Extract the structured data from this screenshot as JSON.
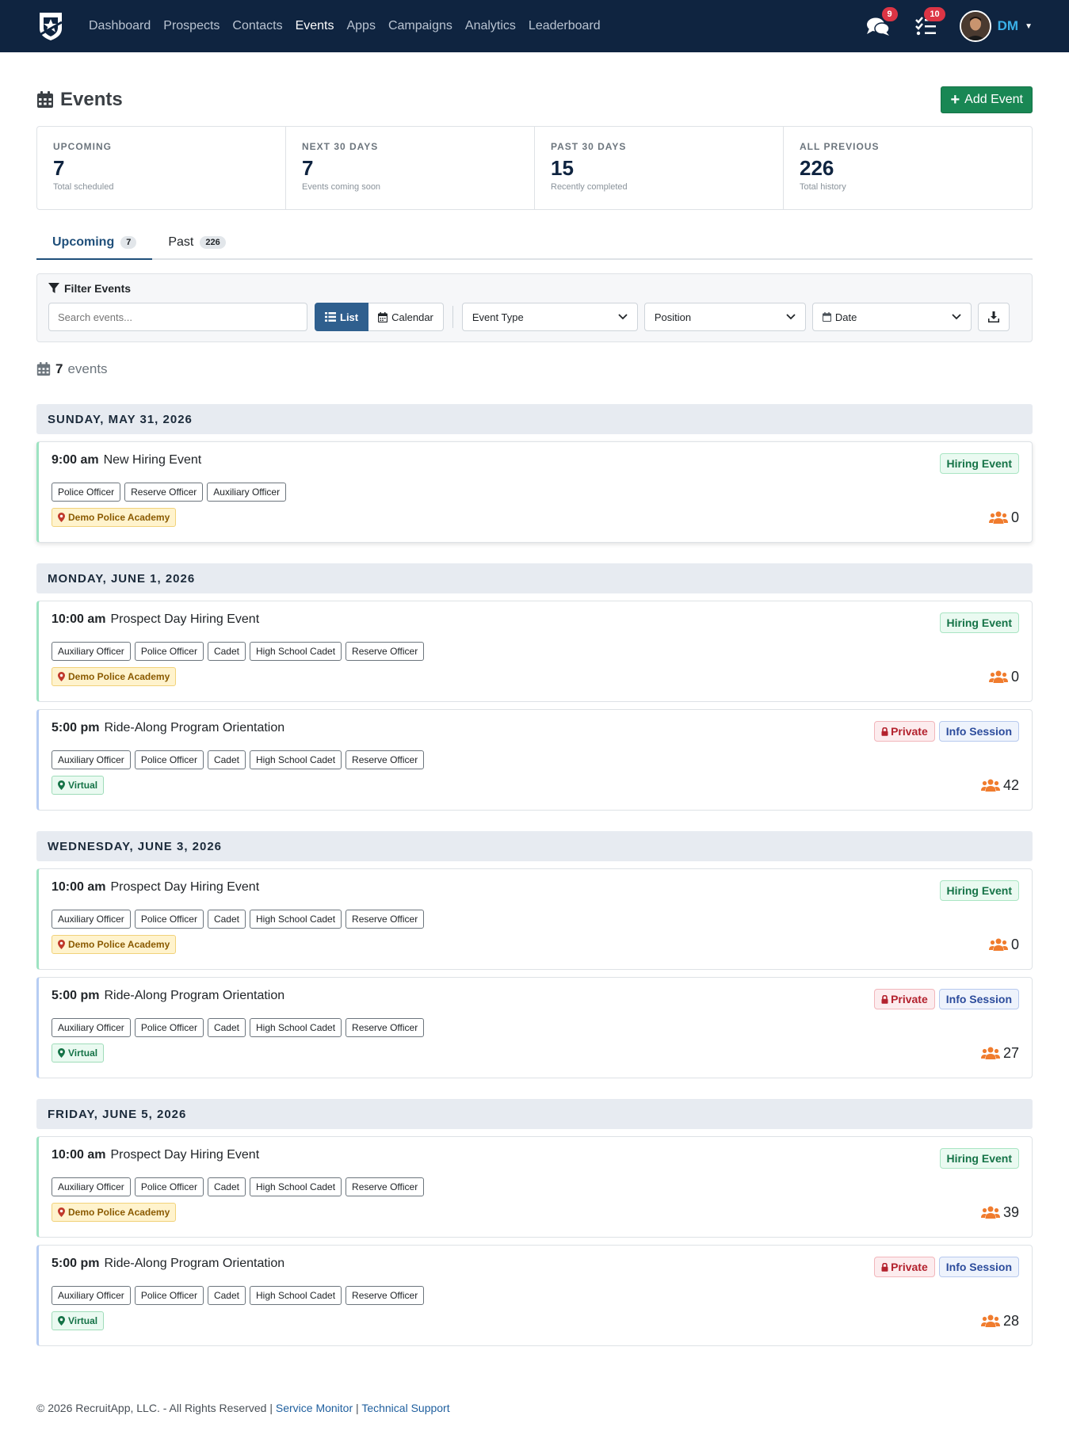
{
  "nav": {
    "links": [
      "Dashboard",
      "Prospects",
      "Contacts",
      "Events",
      "Apps",
      "Campaigns",
      "Analytics",
      "Leaderboard"
    ],
    "active": "Events",
    "messages_badge": "9",
    "tasks_badge": "10",
    "user_initials": "DM"
  },
  "page": {
    "title": "Events",
    "add_button": "Add Event"
  },
  "stats": [
    {
      "label": "UPCOMING",
      "value": "7",
      "sub": "Total scheduled"
    },
    {
      "label": "NEXT 30 DAYS",
      "value": "7",
      "sub": "Events coming soon"
    },
    {
      "label": "PAST 30 DAYS",
      "value": "15",
      "sub": "Recently completed"
    },
    {
      "label": "ALL PREVIOUS",
      "value": "226",
      "sub": "Total history"
    }
  ],
  "tabs": [
    {
      "label": "Upcoming",
      "count": "7"
    },
    {
      "label": "Past",
      "count": "226"
    }
  ],
  "filter": {
    "title": "Filter Events",
    "search_placeholder": "Search events...",
    "list_label": "List",
    "calendar_label": "Calendar",
    "event_type": "Event Type",
    "position": "Position",
    "date": "Date"
  },
  "events_count": {
    "number": "7",
    "label": "events"
  },
  "days": [
    {
      "date": "SUNDAY, MAY 31, 2026",
      "events": [
        {
          "time": "9:00 am",
          "title": "New Hiring Event",
          "private": false,
          "type": "Hiring Event",
          "positions": [
            "Police Officer",
            "Reserve Officer",
            "Auxiliary Officer"
          ],
          "location": "Demo Police Academy",
          "attendees": "0"
        }
      ]
    },
    {
      "date": "MONDAY, JUNE 1, 2026",
      "events": [
        {
          "time": "10:00 am",
          "title": "Prospect Day Hiring Event",
          "private": false,
          "type": "Hiring Event",
          "positions": [
            "Auxiliary Officer",
            "Police Officer",
            "Cadet",
            "High School Cadet",
            "Reserve Officer"
          ],
          "location": "Demo Police Academy",
          "attendees": "0"
        },
        {
          "time": "5:00 pm",
          "title": "Ride-Along Program Orientation",
          "private": true,
          "type": "Info Session",
          "positions": [
            "Auxiliary Officer",
            "Police Officer",
            "Cadet",
            "High School Cadet",
            "Reserve Officer"
          ],
          "location": "Virtual",
          "attendees": "42"
        }
      ]
    },
    {
      "date": "WEDNESDAY, JUNE 3, 2026",
      "events": [
        {
          "time": "10:00 am",
          "title": "Prospect Day Hiring Event",
          "private": false,
          "type": "Hiring Event",
          "positions": [
            "Auxiliary Officer",
            "Police Officer",
            "Cadet",
            "High School Cadet",
            "Reserve Officer"
          ],
          "location": "Demo Police Academy",
          "attendees": "0"
        },
        {
          "time": "5:00 pm",
          "title": "Ride-Along Program Orientation",
          "private": true,
          "type": "Info Session",
          "positions": [
            "Auxiliary Officer",
            "Police Officer",
            "Cadet",
            "High School Cadet",
            "Reserve Officer"
          ],
          "location": "Virtual",
          "attendees": "27"
        }
      ]
    },
    {
      "date": "FRIDAY, JUNE 5, 2026",
      "events": [
        {
          "time": "10:00 am",
          "title": "Prospect Day Hiring Event",
          "private": false,
          "type": "Hiring Event",
          "positions": [
            "Auxiliary Officer",
            "Police Officer",
            "Cadet",
            "High School Cadet",
            "Reserve Officer"
          ],
          "location": "Demo Police Academy",
          "attendees": "39"
        },
        {
          "time": "5:00 pm",
          "title": "Ride-Along Program Orientation",
          "private": true,
          "type": "Info Session",
          "positions": [
            "Auxiliary Officer",
            "Police Officer",
            "Cadet",
            "High School Cadet",
            "Reserve Officer"
          ],
          "location": "Virtual",
          "attendees": "28"
        }
      ]
    }
  ],
  "private_label": "Private",
  "footer": {
    "copyright": "© 2026 RecruitApp, LLC. - All Rights Reserved |",
    "link1": "Service Monitor",
    "sep": "|",
    "link2": "Technical Support"
  },
  "colors": {
    "navbar": "#0f2440",
    "accent": "#198754",
    "attendee_icon": "#f07c2e"
  }
}
